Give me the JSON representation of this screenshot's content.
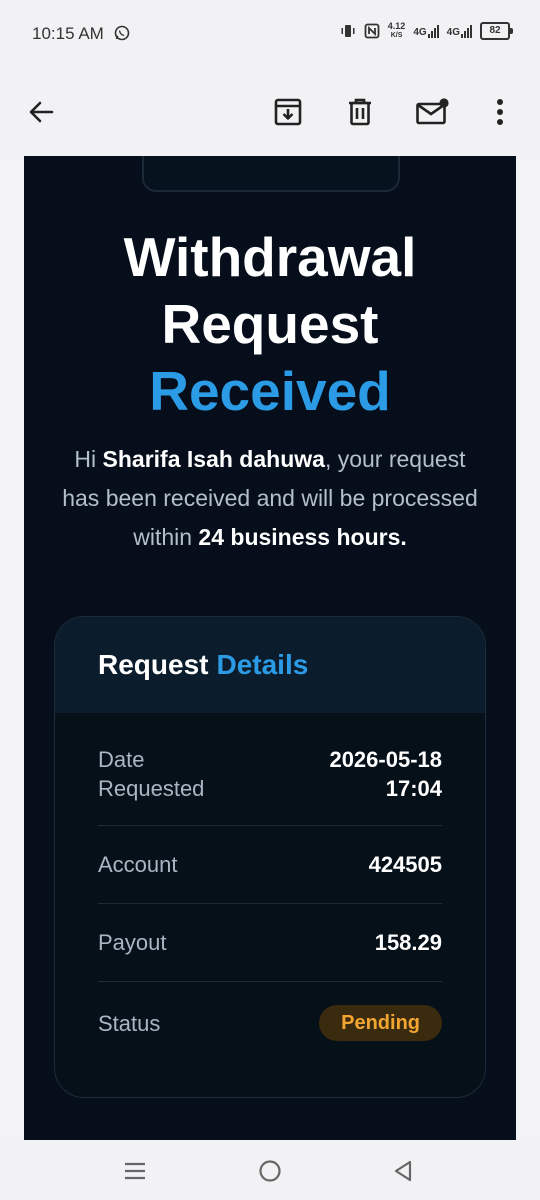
{
  "status_bar": {
    "time": "10:15 AM",
    "net_speed_value": "4.12",
    "net_speed_unit": "K/S",
    "network_1": "4G",
    "network_2": "4G",
    "battery": "82"
  },
  "toolbar": {
    "back_icon": "arrow-left-icon",
    "archive_icon": "archive-icon",
    "delete_icon": "trash-icon",
    "mark_unread_icon": "mail-unread-icon",
    "more_icon": "more-vert-icon"
  },
  "email": {
    "title_line1": "Withdrawal",
    "title_line2": "Request",
    "title_line3": "Received",
    "intro_prefix": "Hi ",
    "user_name": "Sharifa Isah dahuwa",
    "intro_middle": ", your request has been received and will be processed within ",
    "intro_emphasis": "24 business hours.",
    "details_title": "Request",
    "details_title_accent": "Details",
    "rows": [
      {
        "label": "Date Requested",
        "value": "2026-05-18 17:04"
      },
      {
        "label": "Account",
        "value": "424505"
      },
      {
        "label": "Payout",
        "value": "158.29"
      },
      {
        "label": "Status",
        "value": "Pending"
      }
    ]
  },
  "colors": {
    "accent": "#2c9be6",
    "background": "#050e1a",
    "pending_text": "#f3a532",
    "pending_bg": "#3a2a0e"
  },
  "navbar": {
    "recents_icon": "menu-icon",
    "home_icon": "home-circle-icon",
    "back_icon": "back-triangle-icon"
  }
}
